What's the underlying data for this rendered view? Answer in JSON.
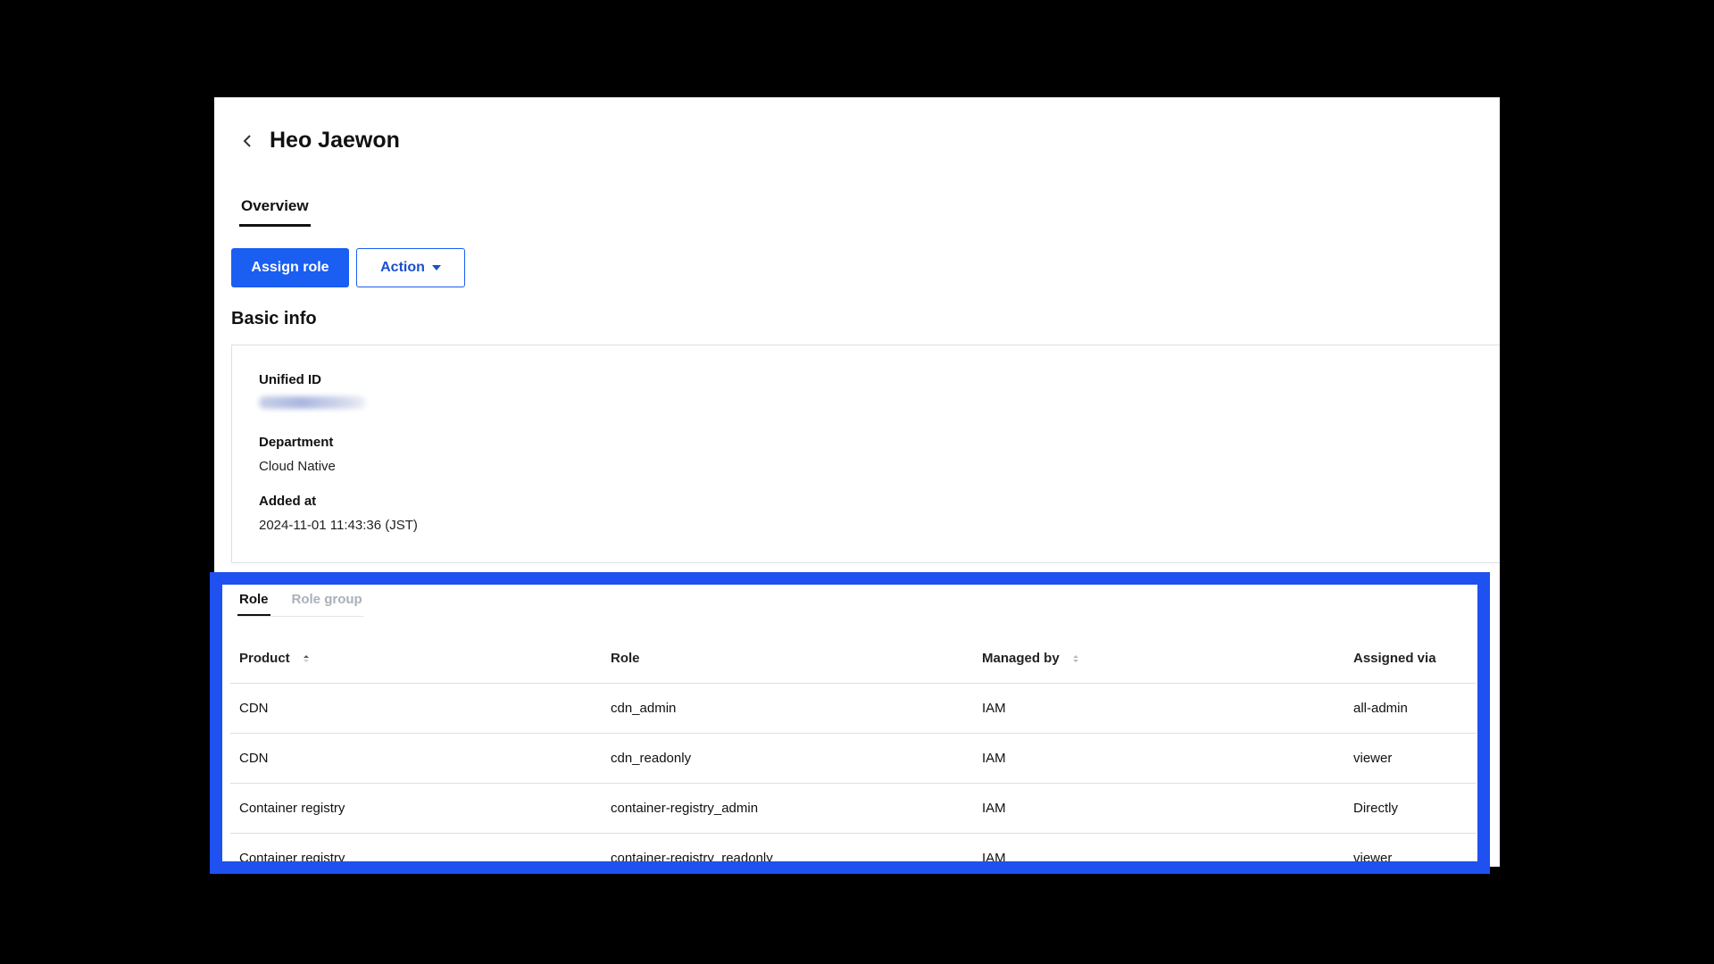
{
  "header": {
    "title": "Heo Jaewon"
  },
  "tabs": [
    {
      "label": "Overview"
    }
  ],
  "toolbar": {
    "assign_label": "Assign role",
    "action_label": "Action"
  },
  "basic_info": {
    "title": "Basic info",
    "unified_id_label": "Unified ID",
    "department_label": "Department",
    "department_value": "Cloud Native",
    "added_at_label": "Added at",
    "added_at_value": "2024-11-01 11:43:36 (JST)"
  },
  "role_tabs": [
    {
      "label": "Role"
    },
    {
      "label": "Role group"
    }
  ],
  "table": {
    "headers": {
      "product": "Product",
      "role": "Role",
      "managed_by": "Managed by",
      "assigned_via": "Assigned via"
    },
    "rows": [
      {
        "product": "CDN",
        "role": "cdn_admin",
        "managed_by": "IAM",
        "assigned_via": "all-admin"
      },
      {
        "product": "CDN",
        "role": "cdn_readonly",
        "managed_by": "IAM",
        "assigned_via": "viewer"
      },
      {
        "product": "Container registry",
        "role": "container-registry_admin",
        "managed_by": "IAM",
        "assigned_via": "Directly"
      },
      {
        "product": "Container registry",
        "role": "container-registry_readonly",
        "managed_by": "IAM",
        "assigned_via": "viewer"
      }
    ]
  },
  "colors": {
    "primary": "#1a5ef2",
    "link": "#1a55d6",
    "highlight": "#1f50f0"
  }
}
